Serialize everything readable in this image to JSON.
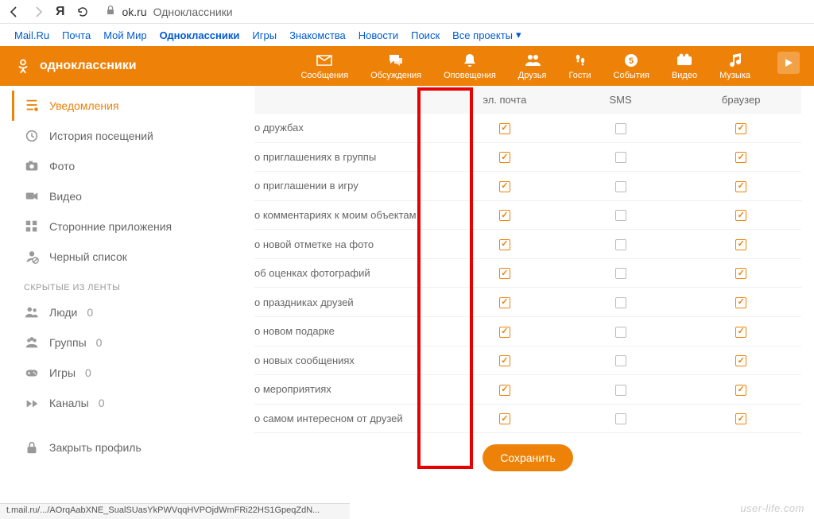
{
  "browser": {
    "url_host": "ok.ru",
    "page_title": "Одноклассники"
  },
  "topnav": {
    "items": [
      "Mail.Ru",
      "Почта",
      "Мой Мир",
      "Одноклассники",
      "Игры",
      "Знакомства",
      "Новости",
      "Поиск",
      "Все проекты"
    ],
    "active_index": 3
  },
  "brand": "одноклассники",
  "orange_nav": {
    "items": [
      {
        "icon": "mail",
        "label": "Сообщения"
      },
      {
        "icon": "chat",
        "label": "Обсуждения"
      },
      {
        "icon": "bell",
        "label": "Оповещения"
      },
      {
        "icon": "friends",
        "label": "Друзья"
      },
      {
        "icon": "steps",
        "label": "Гости"
      },
      {
        "icon": "events",
        "label": "События"
      },
      {
        "icon": "video",
        "label": "Видео"
      },
      {
        "icon": "music",
        "label": "Музыка"
      }
    ]
  },
  "sidebar": {
    "items1": [
      {
        "icon": "notify",
        "label": "Уведомления",
        "active": true
      },
      {
        "icon": "history",
        "label": "История посещений"
      },
      {
        "icon": "camera",
        "label": "Фото"
      },
      {
        "icon": "videocam",
        "label": "Видео"
      },
      {
        "icon": "apps",
        "label": "Сторонние приложения"
      },
      {
        "icon": "blacklist",
        "label": "Черный список"
      }
    ],
    "hidden_header": "СКРЫТЫЕ ИЗ ЛЕНТЫ",
    "items2": [
      {
        "icon": "people",
        "label": "Люди",
        "count": 0
      },
      {
        "icon": "groups",
        "label": "Группы",
        "count": 0
      },
      {
        "icon": "games",
        "label": "Игры",
        "count": 0
      },
      {
        "icon": "channels",
        "label": "Каналы",
        "count": 0
      }
    ],
    "items3": [
      {
        "icon": "lock",
        "label": "Закрыть профиль"
      }
    ]
  },
  "table": {
    "headers": {
      "email": "эл. почта",
      "sms": "SMS",
      "browser": "браузер"
    },
    "rows": [
      {
        "label": "о дружбах",
        "email": true,
        "sms": false,
        "browser": true
      },
      {
        "label": "о приглашениях в группы",
        "email": true,
        "sms": false,
        "browser": true
      },
      {
        "label": "о приглашении в игру",
        "email": true,
        "sms": false,
        "browser": true
      },
      {
        "label": "о комментариях к моим объектам",
        "email": true,
        "sms": false,
        "browser": true
      },
      {
        "label": "о новой отметке на фото",
        "email": true,
        "sms": false,
        "browser": true
      },
      {
        "label": "об оценках фотографий",
        "email": true,
        "sms": false,
        "browser": true
      },
      {
        "label": "о праздниках друзей",
        "email": true,
        "sms": false,
        "browser": true
      },
      {
        "label": "о новом подарке",
        "email": true,
        "sms": false,
        "browser": true
      },
      {
        "label": "о новых сообщениях",
        "email": true,
        "sms": false,
        "browser": true
      },
      {
        "label": "о мероприятиях",
        "email": true,
        "sms": false,
        "browser": true
      },
      {
        "label": "о самом интересном от друзей",
        "email": true,
        "sms": false,
        "browser": true
      }
    ],
    "save_label": "Сохранить"
  },
  "status_bar": "t.mail.ru/.../AOrqAabXNE_SualSUasYkPWVqqHVPOjdWmFRi22HS1GpeqZdN...",
  "watermark": "user-life.com"
}
